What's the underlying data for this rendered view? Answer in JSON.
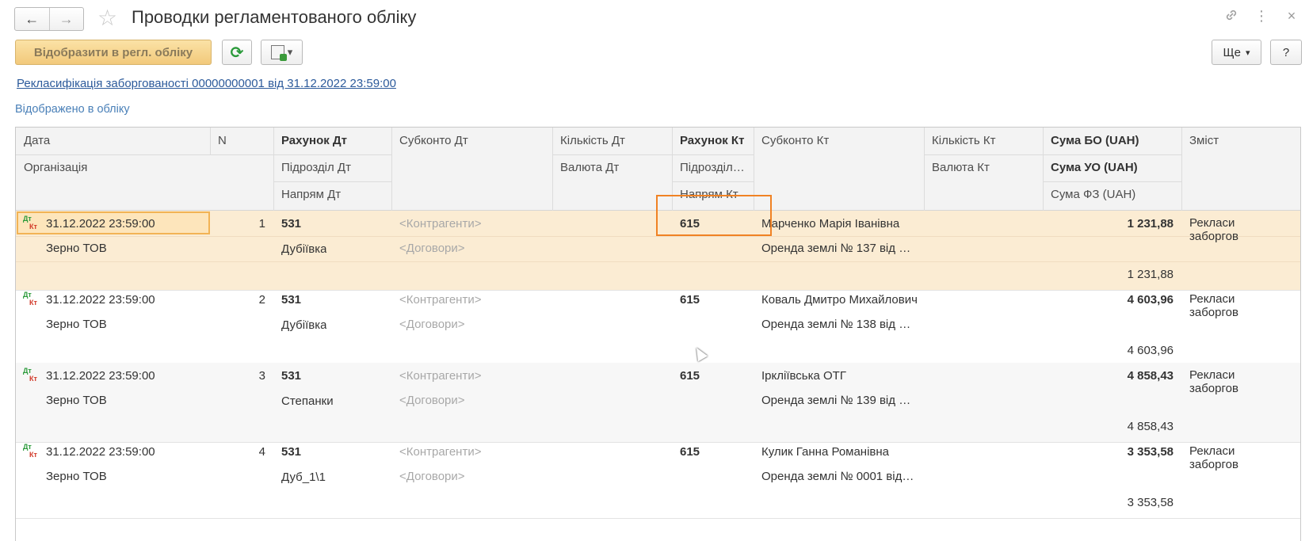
{
  "window": {
    "title": "Проводки регламентованого обліку",
    "back_icon": "←",
    "forward_icon": "→",
    "star_icon": "☆",
    "link_icon": "🔗",
    "menu_icon": "⋮",
    "close_icon": "×"
  },
  "toolbar": {
    "primary_label": "Відобразити в регл. обліку",
    "refresh_icon": "⟳",
    "more_label": "Ще",
    "help_label": "?",
    "dropdown_icon": "▾"
  },
  "document_link": "Рекласифікація заборгованості 00000000001 від 31.12.2022 23:59:00",
  "status": "Відображено в обліку",
  "columns": {
    "date": "Дата",
    "n": "N",
    "org": "Організація",
    "acc_dt": "Рахунок Дт",
    "subdiv_dt": "Підрозділ Дт",
    "dir_dt": "Напрям Дт",
    "subconto_dt": "Субконто Дт",
    "qty_dt": "Кількість Дт",
    "cur_dt": "Валюта Дт",
    "acc_kt": "Рахунок Кт",
    "subdiv_kt": "Підрозділ…",
    "dir_kt": "Напрям Кт",
    "subconto_kt": "Субконто Кт",
    "qty_kt": "Кількість Кт",
    "cur_kt": "Валюта Кт",
    "sum_bo": "Сума БО (UAH)",
    "sum_uo": "Сума УО (UAH)",
    "sum_fz": "Сума ФЗ (UAH)",
    "content": "Зміст"
  },
  "dtkt_dt": "Дт",
  "dtkt_kt": "Кт",
  "rows": [
    {
      "date": "31.12.2022 23:59:00",
      "n": "1",
      "org": "Зерно ТОВ",
      "acc_dt": "531",
      "subdiv_dt": "Дубіївка",
      "sub_dt1": "<Контрагенти>",
      "sub_dt2": "<Договори>",
      "acc_kt": "615",
      "sub_kt1": "Марченко Марія Іванівна",
      "sub_kt2": "Оренда землі № 137 від …",
      "sum_bo": "1 231,88",
      "sum_fz": "1 231,88",
      "content1": "Рекласи",
      "content2": "заборгов"
    },
    {
      "date": "31.12.2022 23:59:00",
      "n": "2",
      "org": "Зерно ТОВ",
      "acc_dt": "531",
      "subdiv_dt": "Дубіївка",
      "sub_dt1": "<Контрагенти>",
      "sub_dt2": "<Договори>",
      "acc_kt": "615",
      "sub_kt1": "Коваль Дмитро Михайлович",
      "sub_kt2": "Оренда землі № 138 від …",
      "sum_bo": "4 603,96",
      "sum_fz": "4 603,96",
      "content1": "Рекласи",
      "content2": "заборгов"
    },
    {
      "date": "31.12.2022 23:59:00",
      "n": "3",
      "org": "Зерно ТОВ",
      "acc_dt": "531",
      "subdiv_dt": "Степанки",
      "sub_dt1": "<Контрагенти>",
      "sub_dt2": "<Договори>",
      "acc_kt": "615",
      "sub_kt1": "Іркліївська ОТГ",
      "sub_kt2": "Оренда землі № 139 від …",
      "sum_bo": "4 858,43",
      "sum_fz": "4 858,43",
      "content1": "Рекласи",
      "content2": "заборгов"
    },
    {
      "date": "31.12.2022 23:59:00",
      "n": "4",
      "org": "Зерно ТОВ",
      "acc_dt": "531",
      "subdiv_dt": "Дуб_1\\1",
      "sub_dt1": "<Контрагенти>",
      "sub_dt2": "<Договори>",
      "acc_kt": "615",
      "sub_kt1": "Кулик Ганна Романівна",
      "sub_kt2": "Оренда землі № 0001 від…",
      "sum_bo": "3 353,58",
      "sum_fz": "3 353,58",
      "content1": "Рекласи",
      "content2": "заборгов"
    }
  ]
}
